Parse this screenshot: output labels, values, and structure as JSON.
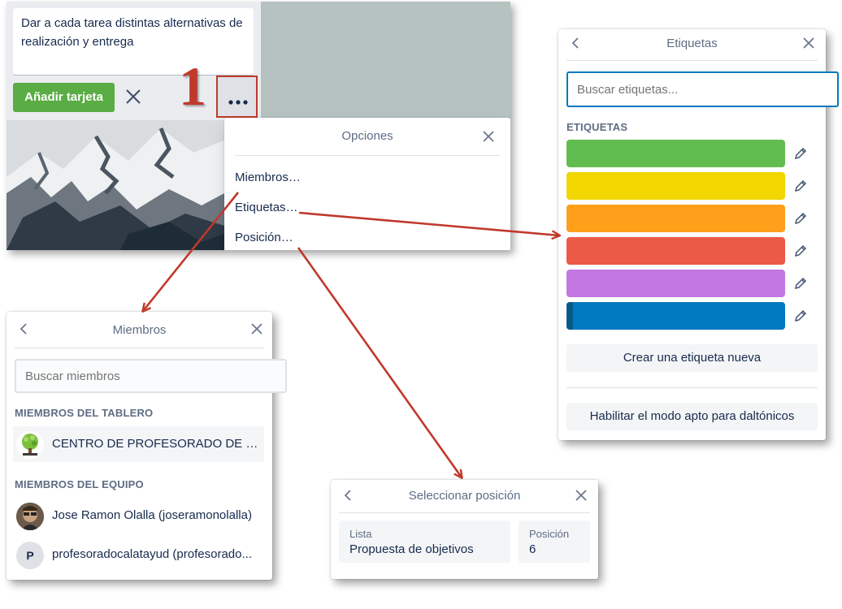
{
  "card_editor": {
    "card_text": "Dar a cada tarea distintas alternativas de realización y entrega",
    "add_card_button": "Añadir tarjeta",
    "close_icon": "close-icon",
    "more_icon": "ellipsis-icon",
    "step_number": "1"
  },
  "options_menu": {
    "title": "Opciones",
    "items": [
      "Miembros…",
      "Etiquetas…",
      "Posición…"
    ]
  },
  "labels_popover": {
    "title": "Etiquetas",
    "search_placeholder": "Buscar etiquetas...",
    "section_title": "ETIQUETAS",
    "labels": [
      {
        "color": "#61bd4f"
      },
      {
        "color": "#f2d600"
      },
      {
        "color": "#ff9f1a"
      },
      {
        "color": "#eb5a46"
      },
      {
        "color": "#c377e0"
      },
      {
        "color": "#0079bf",
        "selected_marker": "#055a8c"
      }
    ],
    "create_button": "Crear una etiqueta nueva",
    "colorblind_button": "Habilitar el modo apto para daltónicos"
  },
  "members_popover": {
    "title": "Miembros",
    "search_placeholder": "Buscar miembros",
    "board_section": "MIEMBROS DEL TABLERO",
    "board_members": [
      "CENTRO DE PROFESORADO DE CA..."
    ],
    "team_section": "MIEMBROS DEL EQUIPO",
    "team_members": [
      {
        "name": "Jose Ramon Olalla (joseramonolalla)"
      },
      {
        "name": "profesoradocalatayud (profesorado...",
        "initial": "P"
      }
    ]
  },
  "position_popover": {
    "title": "Seleccionar posición",
    "list_label": "Lista",
    "list_value": "Propuesta de objetivos",
    "position_label": "Posición",
    "position_value": "6"
  },
  "colors": {
    "green_button": "#5aac44",
    "annotation_red": "#c0392b",
    "focus_blue": "#0079bf"
  }
}
